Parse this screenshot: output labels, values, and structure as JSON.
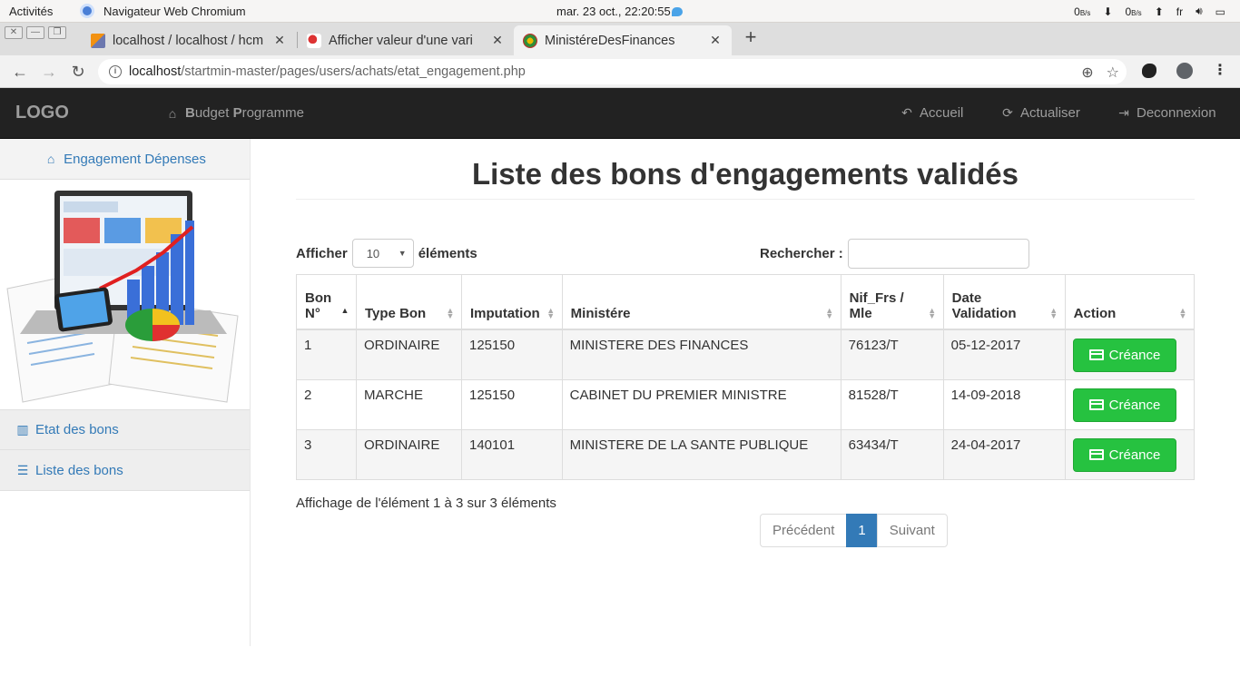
{
  "system_bar": {
    "activities": "Activités",
    "app_name": "Navigateur Web Chromium",
    "clock": "mar. 23 oct., 22:20:55",
    "net_down": "0",
    "net_down_unit": "B/s",
    "net_up": "0",
    "net_up_unit": "B/s",
    "lang": "fr"
  },
  "tabs": [
    {
      "title": "localhost / localhost / hcm",
      "icon": "phpmyadmin-icon"
    },
    {
      "title": "Afficher valeur d'une vari",
      "icon": "site-icon"
    },
    {
      "title": "MinistéreDesFinances",
      "icon": "emblem-icon"
    }
  ],
  "address": {
    "host": "localhost",
    "path": "/startmin-master/pages/users/achats/etat_engagement.php"
  },
  "navbar": {
    "brand": "LOGO",
    "program_b1": "B",
    "program_t1": "udget ",
    "program_b2": "P",
    "program_t2": "rogramme",
    "home": "Accueil",
    "refresh": "Actualiser",
    "logout": "Deconnexion"
  },
  "sidebar": {
    "header": "Engagement Dépenses",
    "items": [
      {
        "label": "Etat des bons"
      },
      {
        "label": "Liste des bons"
      }
    ]
  },
  "main": {
    "title": "Liste des bons d'engagements validés",
    "show_prefix": "Afficher",
    "page_length": "10",
    "show_suffix": "éléments",
    "search_label": "Rechercher :",
    "search_value": "",
    "columns": [
      "Bon N°",
      "Type Bon",
      "Imputation",
      "Ministére",
      "Nif_Frs / Mle",
      "Date Validation",
      "Action"
    ],
    "rows": [
      {
        "bon": "1",
        "type": "ORDINAIRE",
        "imputation": "125150",
        "ministere": "MINISTERE DES FINANCES",
        "nif": "76123/T",
        "date": "05-12-2017",
        "action": "Créance"
      },
      {
        "bon": "2",
        "type": "MARCHE",
        "imputation": "125150",
        "ministere": "CABINET DU PREMIER MINISTRE",
        "nif": "81528/T",
        "date": "14-09-2018",
        "action": "Créance"
      },
      {
        "bon": "3",
        "type": "ORDINAIRE",
        "imputation": "140101",
        "ministere": "MINISTERE DE LA SANTE PUBLIQUE",
        "nif": "63434/T",
        "date": "24-04-2017",
        "action": "Créance"
      }
    ],
    "info": "Affichage de l'élément 1 à 3 sur 3 éléments",
    "pagination": {
      "prev": "Précédent",
      "current": "1",
      "next": "Suivant"
    }
  },
  "colors": {
    "navbar_bg": "#222222",
    "link": "#337ab7",
    "success": "#26c240",
    "pager_active": "#337ab7"
  }
}
